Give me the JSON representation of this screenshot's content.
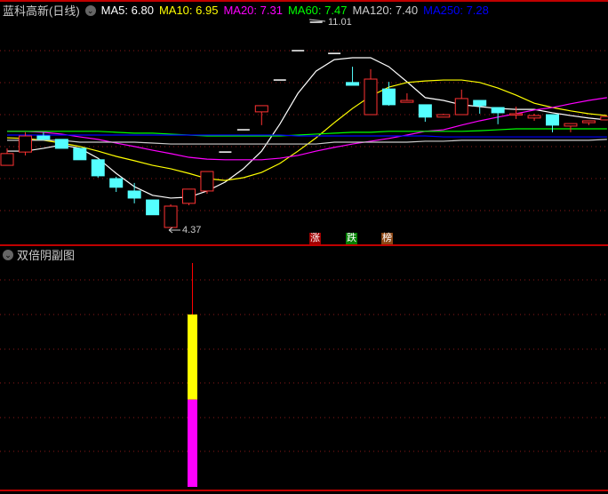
{
  "header": {
    "title": "蓝科高新(日线)",
    "ma": [
      {
        "label": "MA5: 6.80",
        "color": "#ffffff"
      },
      {
        "label": "MA10: 6.95",
        "color": "#ffff00"
      },
      {
        "label": "MA20: 7.31",
        "color": "#ff00ff"
      },
      {
        "label": "MA60: 7.47",
        "color": "#00ff00"
      },
      {
        "label": "MA120: 7.40",
        "color": "#cccccc"
      },
      {
        "label": "MA250: 7.28",
        "color": "#0000ff"
      }
    ]
  },
  "annotations": {
    "high": "11.01",
    "low": "4.37"
  },
  "tags": [
    {
      "label": "涨",
      "color": "#a00000"
    },
    {
      "label": "跌",
      "color": "#008000"
    },
    {
      "label": "榜",
      "color": "#8b4513"
    }
  ],
  "sub_panel": {
    "title": "双倍阴副图",
    "bar_index": 10,
    "line_top": 1.0,
    "yellow_top": 0.77,
    "split": 0.39
  },
  "chart_data": {
    "type": "candlestick",
    "ylim": [
      4.37,
      11.01
    ],
    "up_color": "#ff3232",
    "down_color": "#54ffff",
    "candles": [
      [
        6.38,
        6.93,
        6.38,
        6.76
      ],
      [
        6.81,
        7.45,
        6.7,
        7.33
      ],
      [
        7.33,
        7.45,
        7.22,
        7.22
      ],
      [
        7.22,
        7.22,
        6.93,
        6.93
      ],
      [
        6.93,
        6.93,
        6.56,
        6.56
      ],
      [
        6.56,
        6.56,
        5.98,
        6.04
      ],
      [
        5.95,
        6.01,
        5.52,
        5.67
      ],
      [
        5.55,
        5.81,
        5.15,
        5.32
      ],
      [
        5.26,
        5.26,
        4.78,
        4.78
      ],
      [
        4.37,
        5.12,
        4.37,
        5.06
      ],
      [
        5.15,
        5.61,
        5.09,
        5.61
      ],
      [
        5.55,
        6.18,
        5.46,
        6.18
      ],
      [
        6.81,
        6.81,
        6.81,
        6.81
      ],
      [
        7.53,
        7.53,
        7.53,
        7.53
      ],
      [
        8.11,
        8.31,
        7.68,
        8.31
      ],
      [
        9.14,
        9.14,
        9.14,
        9.14
      ],
      [
        10.09,
        10.09,
        10.09,
        10.09
      ],
      [
        11.01,
        11.01,
        11.01,
        11.01
      ],
      [
        10.0,
        10.0,
        10.0,
        10.0
      ],
      [
        9.06,
        9.57,
        8.97,
        8.97
      ],
      [
        8.02,
        9.49,
        8.02,
        9.17
      ],
      [
        8.85,
        9.08,
        8.31,
        8.34
      ],
      [
        8.42,
        8.71,
        8.42,
        8.48
      ],
      [
        8.34,
        8.34,
        7.79,
        7.94
      ],
      [
        7.94,
        8.05,
        7.94,
        8.02
      ],
      [
        8.02,
        8.83,
        8.02,
        8.54
      ],
      [
        8.48,
        8.48,
        8.05,
        8.31
      ],
      [
        8.25,
        8.25,
        7.71,
        8.08
      ],
      [
        8.05,
        8.28,
        7.88,
        8.05
      ],
      [
        7.91,
        8.05,
        7.82,
        7.99
      ],
      [
        8.02,
        8.02,
        7.45,
        7.68
      ],
      [
        7.65,
        7.73,
        7.45,
        7.73
      ],
      [
        7.76,
        7.82,
        7.68,
        7.82
      ],
      [
        7.85,
        7.96,
        7.85,
        7.96
      ]
    ],
    "series": [
      {
        "name": "MA5",
        "color": "#ffffff",
        "values": [
          6.84,
          6.84,
          6.93,
          7.04,
          6.93,
          6.61,
          6.12,
          5.69,
          5.41,
          5.32,
          5.35,
          5.55,
          5.84,
          6.27,
          6.84,
          7.71,
          8.71,
          9.43,
          9.8,
          9.86,
          9.86,
          9.57,
          9.08,
          8.57,
          8.48,
          8.34,
          8.28,
          8.22,
          8.19,
          8.19,
          8.08,
          7.99,
          7.91,
          7.85
        ]
      },
      {
        "name": "MA10",
        "color": "#ffff00",
        "values": [
          7.27,
          7.25,
          7.19,
          7.1,
          6.99,
          6.84,
          6.67,
          6.53,
          6.38,
          6.27,
          6.12,
          5.95,
          5.89,
          5.98,
          6.15,
          6.44,
          6.84,
          7.27,
          7.76,
          8.22,
          8.62,
          8.91,
          9.06,
          9.11,
          9.14,
          9.14,
          9.06,
          8.88,
          8.65,
          8.39,
          8.25,
          8.14,
          8.05,
          7.99
        ]
      },
      {
        "name": "MA20",
        "color": "#ff00ff",
        "values": [
          7.48,
          7.48,
          7.45,
          7.39,
          7.3,
          7.22,
          7.1,
          6.99,
          6.87,
          6.76,
          6.64,
          6.58,
          6.56,
          6.56,
          6.56,
          6.61,
          6.7,
          6.84,
          6.96,
          7.07,
          7.16,
          7.25,
          7.36,
          7.48,
          7.53,
          7.68,
          7.82,
          7.94,
          8.05,
          8.17,
          8.25,
          8.37,
          8.48,
          8.57
        ]
      },
      {
        "name": "MA60",
        "color": "#00ff00",
        "values": [
          7.48,
          7.48,
          7.48,
          7.48,
          7.48,
          7.48,
          7.45,
          7.42,
          7.42,
          7.39,
          7.36,
          7.33,
          7.33,
          7.33,
          7.33,
          7.33,
          7.36,
          7.39,
          7.42,
          7.45,
          7.45,
          7.48,
          7.48,
          7.48,
          7.48,
          7.48,
          7.5,
          7.53,
          7.56,
          7.56,
          7.56,
          7.56,
          7.56,
          7.56
        ]
      },
      {
        "name": "MA120",
        "color": "#cccccc",
        "values": [
          7.19,
          7.19,
          7.19,
          7.19,
          7.13,
          7.13,
          7.13,
          7.13,
          7.1,
          7.07,
          7.07,
          7.07,
          7.07,
          7.07,
          7.07,
          7.07,
          7.07,
          7.07,
          7.13,
          7.13,
          7.13,
          7.13,
          7.13,
          7.16,
          7.16,
          7.19,
          7.19,
          7.19,
          7.19,
          7.19,
          7.19,
          7.19,
          7.19,
          7.22
        ]
      },
      {
        "name": "MA250",
        "color": "#0000ff",
        "values": [
          7.36,
          7.36,
          7.36,
          7.36,
          7.36,
          7.36,
          7.36,
          7.36,
          7.36,
          7.36,
          7.36,
          7.36,
          7.36,
          7.36,
          7.36,
          7.36,
          7.33,
          7.33,
          7.33,
          7.33,
          7.33,
          7.33,
          7.33,
          7.33,
          7.3,
          7.3,
          7.3,
          7.3,
          7.3,
          7.3,
          7.3,
          7.3,
          7.3,
          7.3
        ]
      }
    ]
  }
}
